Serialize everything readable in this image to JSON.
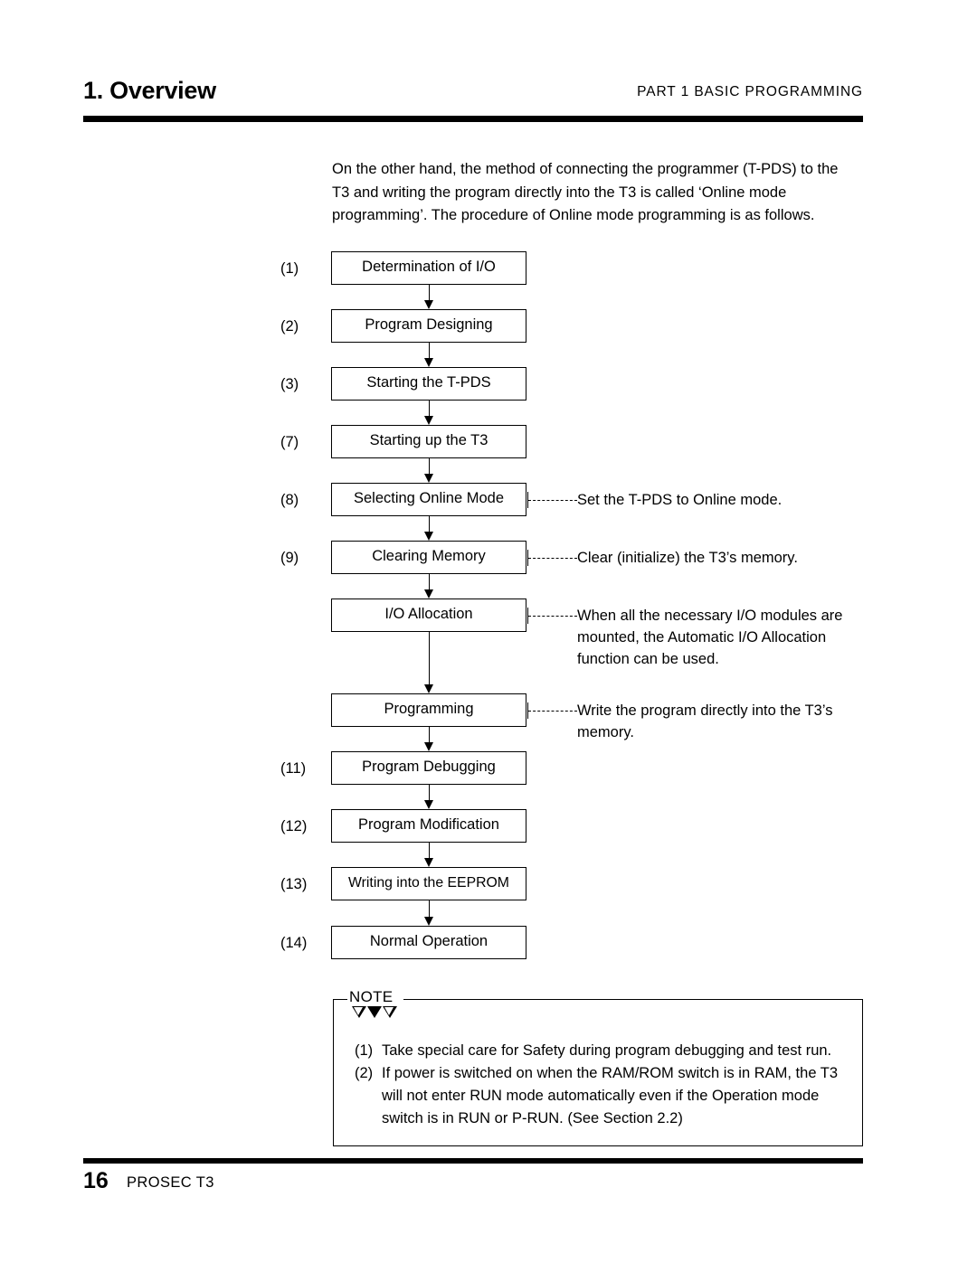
{
  "header": {
    "title": "1. Overview",
    "part": "PART 1  BASIC  PROGRAMMING"
  },
  "intro": {
    "paragraph": "On the other hand, the method of connecting the programmer (T-PDS) to the T3 and writing the program directly into the T3 is called ‘Online mode programming’.  The procedure of Online mode programming is as follows."
  },
  "flowchart": {
    "type": "vertical-flow",
    "steps": [
      {
        "num": "(1)",
        "label": "Determination of I/O",
        "annotation": ""
      },
      {
        "num": "(2)",
        "label": "Program Designing",
        "annotation": ""
      },
      {
        "num": "(3)",
        "label": "Starting the T-PDS",
        "annotation": ""
      },
      {
        "num": "(7)",
        "label": "Starting up the T3",
        "annotation": ""
      },
      {
        "num": "(8)",
        "label": "Selecting Online Mode",
        "annotation": "Set the T-PDS to Online mode."
      },
      {
        "num": "(9)",
        "label": "Clearing Memory",
        "annotation": "Clear (initialize) the T3’s memory."
      },
      {
        "num": "",
        "label": "I/O Allocation",
        "annotation": "When all the necessary I/O modules are mounted, the Automatic I/O Allocation function can be used."
      },
      {
        "num": "",
        "label": "Programming",
        "annotation": "Write the program directly into the T3’s memory."
      },
      {
        "num": "(11)",
        "label": "Program Debugging",
        "annotation": ""
      },
      {
        "num": "(12)",
        "label": "Program Modification",
        "annotation": ""
      },
      {
        "num": "(13)",
        "label": "Writing into the EEPROM",
        "annotation": ""
      },
      {
        "num": "(14)",
        "label": "Normal Operation",
        "annotation": ""
      }
    ]
  },
  "note": {
    "label": "NOTE",
    "items": [
      {
        "marker": "(1)",
        "text": "Take special care for Safety during program debugging and test run."
      },
      {
        "marker": "(2)",
        "text": "If power is switched on when the RAM/ROM switch is in RAM, the T3 will not enter RUN mode automatically even if the Operation mode switch is in RUN or P-RUN.  (See Section 2.2)"
      }
    ]
  },
  "footer": {
    "page": "16",
    "product": "PROSEC T3"
  }
}
